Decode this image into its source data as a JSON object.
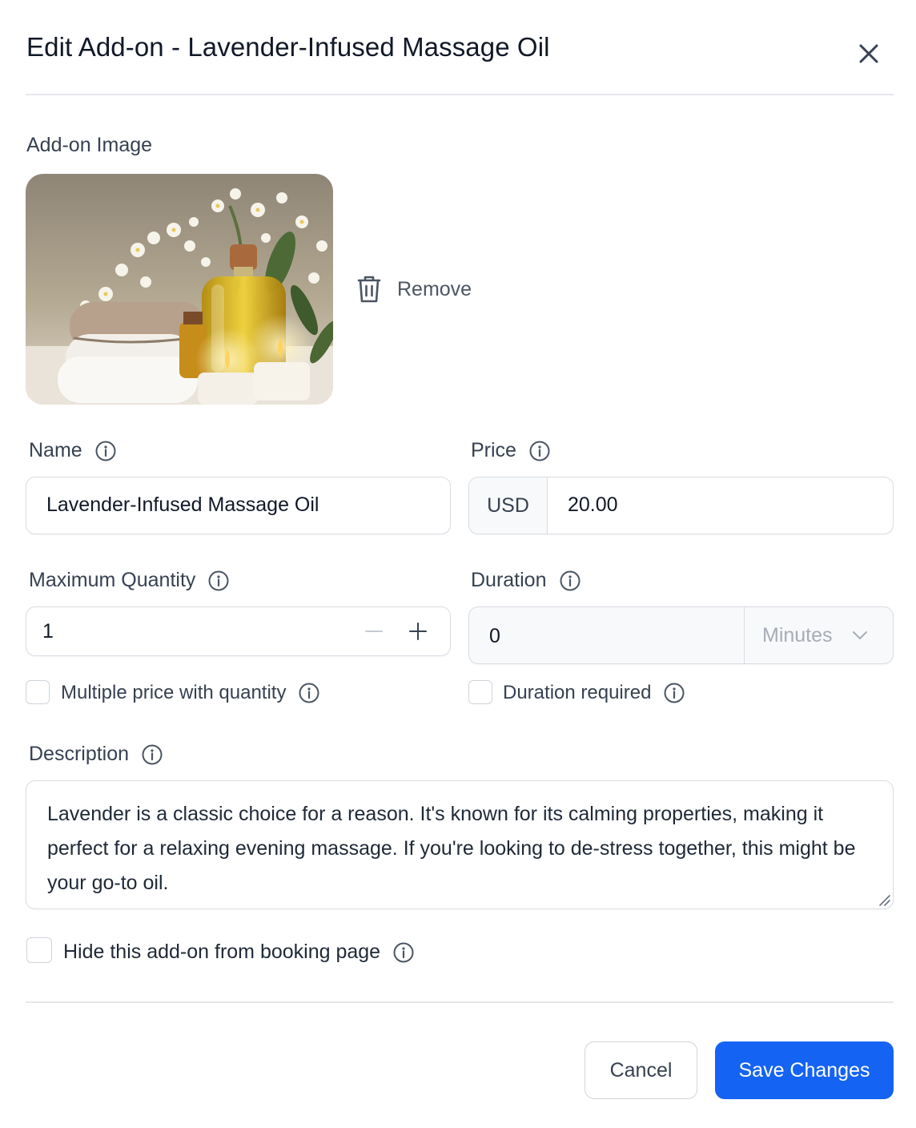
{
  "dialog": {
    "title": "Edit Add-on - Lavender-Infused Massage Oil",
    "close_icon": "close-icon"
  },
  "image_section": {
    "label": "Add-on Image",
    "remove_label": "Remove",
    "remove_icon": "trash-icon"
  },
  "name": {
    "label": "Name",
    "value": "Lavender-Infused Massage Oil"
  },
  "price": {
    "label": "Price",
    "currency": "USD",
    "value": "20.00"
  },
  "max_quantity": {
    "label": "Maximum Quantity",
    "value": "1"
  },
  "duration": {
    "label": "Duration",
    "value": "0",
    "unit": "Minutes"
  },
  "checkboxes": {
    "multiple_price": {
      "label": "Multiple price with quantity",
      "checked": false
    },
    "duration_required": {
      "label": "Duration required",
      "checked": false
    },
    "hide_addon": {
      "label": "Hide this add-on from booking page",
      "checked": false
    }
  },
  "description": {
    "label": "Description",
    "value": "Lavender is a classic choice for a reason. It's known for its calming properties, making it perfect for a relaxing evening massage. If you're looking to de-stress together, this might be your go-to oil."
  },
  "footer": {
    "cancel_label": "Cancel",
    "save_label": "Save Changes"
  },
  "colors": {
    "primary": "#1463f3",
    "border": "#d9dde3",
    "divider": "#e5e7eb"
  }
}
